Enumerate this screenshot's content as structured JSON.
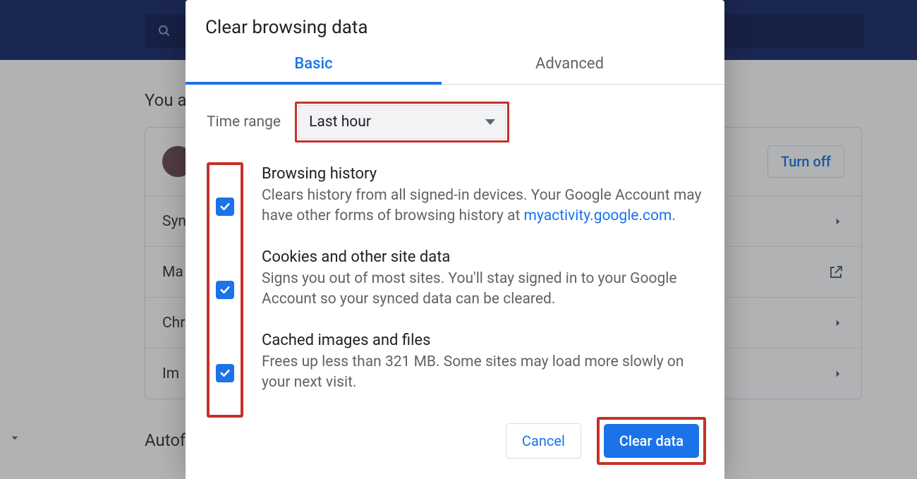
{
  "background": {
    "heading_start": "You a",
    "turn_off": "Turn off",
    "rows": [
      "Syn",
      "Ma",
      "Chr",
      "Im"
    ],
    "autofill": "Autofi"
  },
  "dialog": {
    "title": "Clear browsing data",
    "tabs": {
      "basic": "Basic",
      "advanced": "Advanced"
    },
    "time": {
      "label": "Time range",
      "selected": "Last hour"
    },
    "items": [
      {
        "title": "Browsing history",
        "desc_before": "Clears history from all signed-in devices. Your Google Account may have other forms of browsing history at ",
        "link_text": "myactivity.google.com",
        "desc_after": "."
      },
      {
        "title": "Cookies and other site data",
        "desc_before": "Signs you out of most sites. You'll stay signed in to your Google Account so your synced data can be cleared.",
        "link_text": "",
        "desc_after": ""
      },
      {
        "title": "Cached images and files",
        "desc_before": "Frees up less than 321 MB. Some sites may load more slowly on your next visit.",
        "link_text": "",
        "desc_after": ""
      }
    ],
    "cancel": "Cancel",
    "clear": "Clear data"
  }
}
